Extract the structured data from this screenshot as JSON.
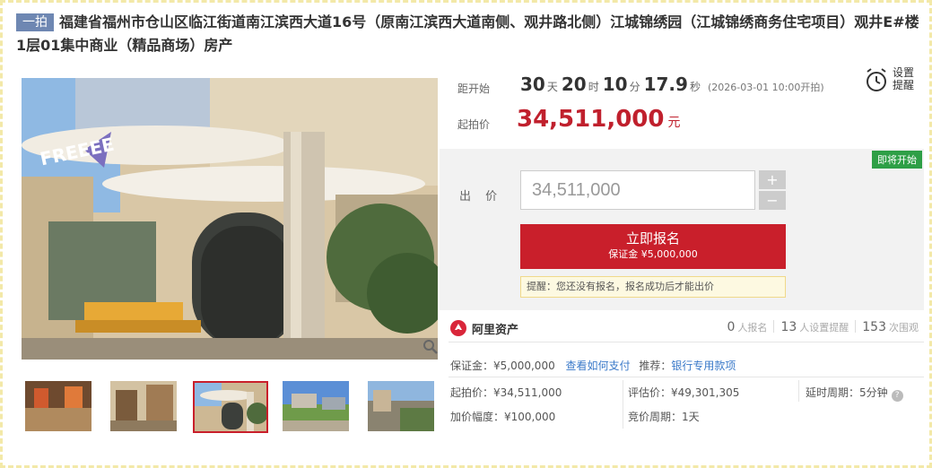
{
  "title": {
    "tag": "一拍",
    "text": "福建省福州市仓山区临江街道南江滨西大道16号（原南江滨西大道南侧、观井路北侧）江城锦绣园（江城锦绣商务住宅项目）观井E#楼1层01集中商业（精品商场）房产"
  },
  "photo": {
    "storefront_sign": "FREEEE"
  },
  "countdown": {
    "label": "距开始",
    "days": "30",
    "days_unit": "天",
    "hours": "20",
    "hours_unit": "时",
    "minutes": "10",
    "minutes_unit": "分",
    "seconds": "17.9",
    "seconds_unit": "秒",
    "start_note": "(2026-03-01 10:00开拍)"
  },
  "alarm": {
    "label_line1": "设置",
    "label_line2": "提醒",
    "icon": "alarm-clock-icon"
  },
  "start_price": {
    "label": "起拍价",
    "value": "34,511,000",
    "unit": "元"
  },
  "bid": {
    "status_badge": "即将开始",
    "label": "出 价",
    "input_value": "34,511,000",
    "plus": "+",
    "minus": "−",
    "signup_label": "立即报名",
    "deposit_line": "保证金 ¥5,000,000",
    "reminder": "提醒：您还没有报名，报名成功后才能出价"
  },
  "platform": {
    "name": "阿里资产",
    "signups_count": "0",
    "signups_label": "人报名",
    "reminders_count": "13",
    "reminders_label": "人设置提醒",
    "views_count": "153",
    "views_label": "次围观"
  },
  "details": {
    "deposit": "保证金：¥5,000,000",
    "how_to_pay": "查看如何支付",
    "recommend_label": "推荐：",
    "recommend_link": "银行专用款项",
    "start_price": "起拍价：¥34,511,000",
    "appraisal": "评估价：¥49,301,305",
    "delay": "延时周期：5分钟",
    "increment": "加价幅度：¥100,000",
    "bid_period": "竞价周期：1天"
  },
  "colors": {
    "accent": "#c91f2b",
    "tag": "#6e87b2",
    "link": "#3b7ac9",
    "badge": "#2e9f46"
  }
}
